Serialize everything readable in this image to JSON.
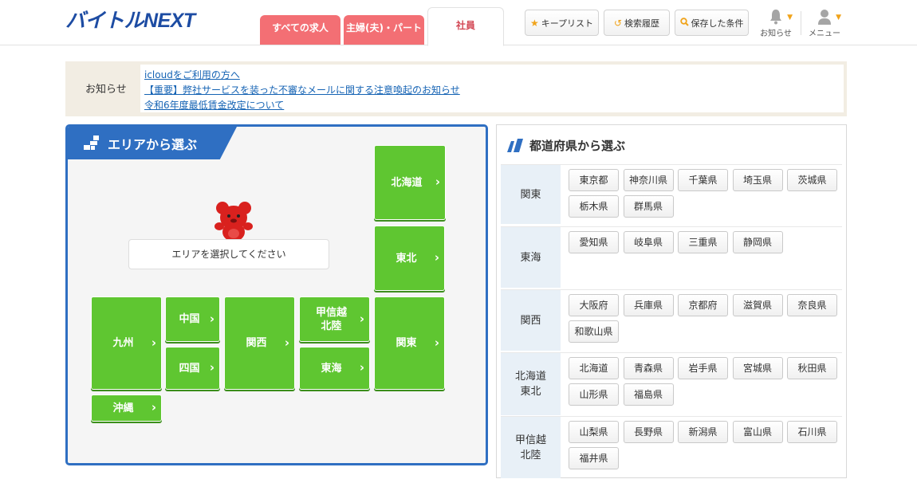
{
  "header": {
    "logo": "バイトルNEXT",
    "tabs": [
      "すべての求人",
      "主婦(夫)・パート",
      "社員"
    ],
    "buttons": [
      "キープリスト",
      "検索履歴",
      "保存した条件"
    ],
    "nav": [
      "お知らせ",
      "メニュー"
    ]
  },
  "notice": {
    "title": "お知らせ",
    "links": [
      "icloudをご利用の方へ",
      "【重要】弊社サービスを装った不審なメールに関する注意喚起のお知らせ",
      "令和6年度最低賃金改定について"
    ]
  },
  "area": {
    "title": "エリアから選ぶ",
    "prompt": "エリアを選択してください",
    "regions": {
      "hokkaido": "北海道",
      "tohoku": "東北",
      "kanto": "関東",
      "koshinetsu": "甲信越\n北陸",
      "tokai": "東海",
      "kansai": "関西",
      "chugoku": "中国",
      "shikoku": "四国",
      "kyushu": "九州",
      "okinawa": "沖縄"
    }
  },
  "pref": {
    "title": "都道府県から選ぶ",
    "regions": [
      {
        "label": "関東",
        "prefs": [
          "東京都",
          "神奈川県",
          "千葉県",
          "埼玉県",
          "茨城県",
          "栃木県",
          "群馬県"
        ]
      },
      {
        "label": "東海",
        "prefs": [
          "愛知県",
          "岐阜県",
          "三重県",
          "静岡県"
        ]
      },
      {
        "label": "関西",
        "prefs": [
          "大阪府",
          "兵庫県",
          "京都府",
          "滋賀県",
          "奈良県",
          "和歌山県"
        ]
      },
      {
        "label": "北海道\n東北",
        "prefs": [
          "北海道",
          "青森県",
          "岩手県",
          "宮城県",
          "秋田県",
          "山形県",
          "福島県"
        ]
      },
      {
        "label": "甲信越\n北陸",
        "prefs": [
          "山梨県",
          "長野県",
          "新潟県",
          "富山県",
          "石川県",
          "福井県"
        ]
      }
    ]
  },
  "colors": {
    "brand_blue": "#1d4ca3",
    "area_blue": "#2f6fc2",
    "green": "#5fc631",
    "tab_pink": "#f36f74",
    "accent_orange": "#f0a31a"
  },
  "icons": [
    "star-icon",
    "history-icon",
    "search-icon",
    "bell-icon",
    "user-icon",
    "chevron-right-icon"
  ]
}
